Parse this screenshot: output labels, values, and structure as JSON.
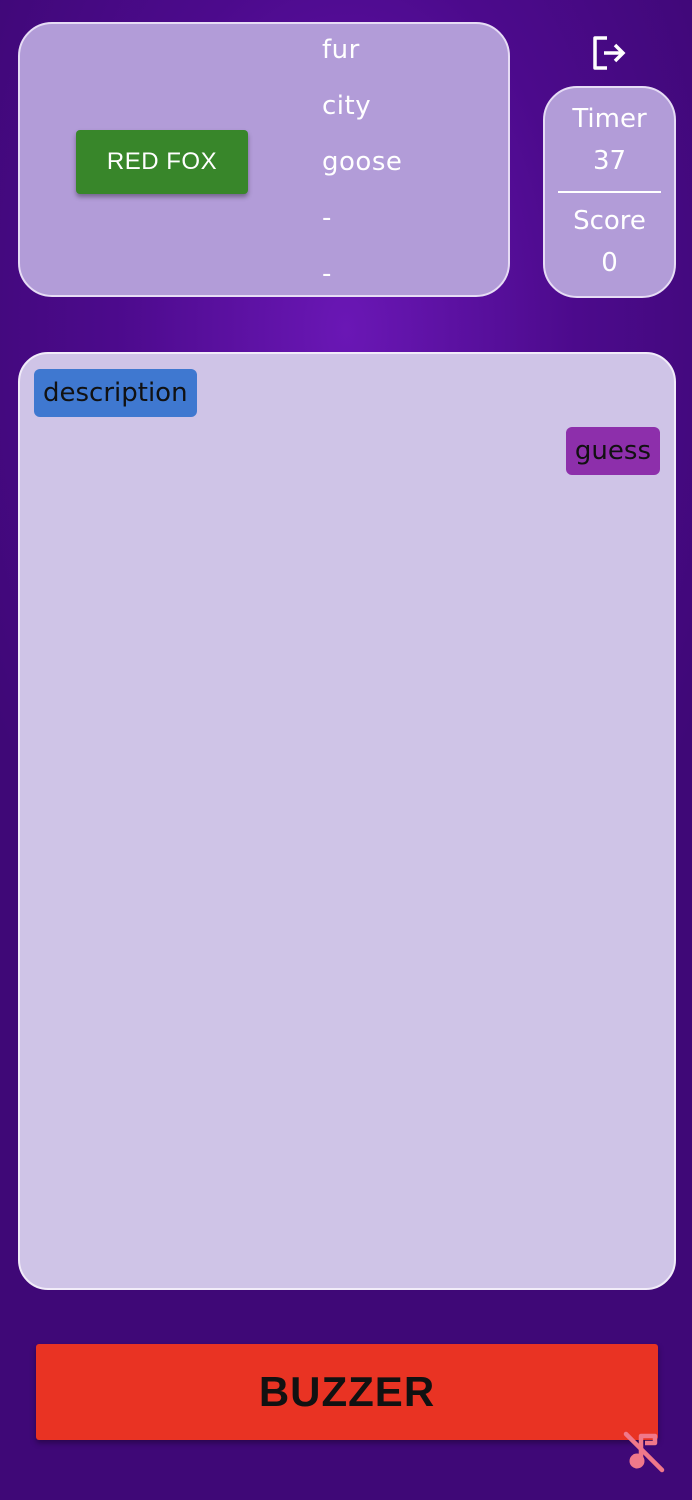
{
  "word_card": {
    "target_word": "RED FOX",
    "taboo_words": [
      "fur",
      "city",
      "goose",
      "-",
      "-"
    ]
  },
  "stats": {
    "timer_label": "Timer",
    "timer_value": "37",
    "score_label": "Score",
    "score_value": "0"
  },
  "chat": {
    "messages": [
      {
        "type": "description",
        "text": "description"
      },
      {
        "type": "guess",
        "text": "guess"
      }
    ]
  },
  "buzzer": {
    "label": "BUZZER"
  },
  "icons": {
    "exit": "exit-icon",
    "music_off": "music-off-icon"
  },
  "colors": {
    "target_word_bg": "#38862a",
    "description_bg": "#3f78d0",
    "guess_bg": "#8d2fab",
    "buzzer_bg": "#e93323",
    "music_off_icon": "#f0788a"
  }
}
